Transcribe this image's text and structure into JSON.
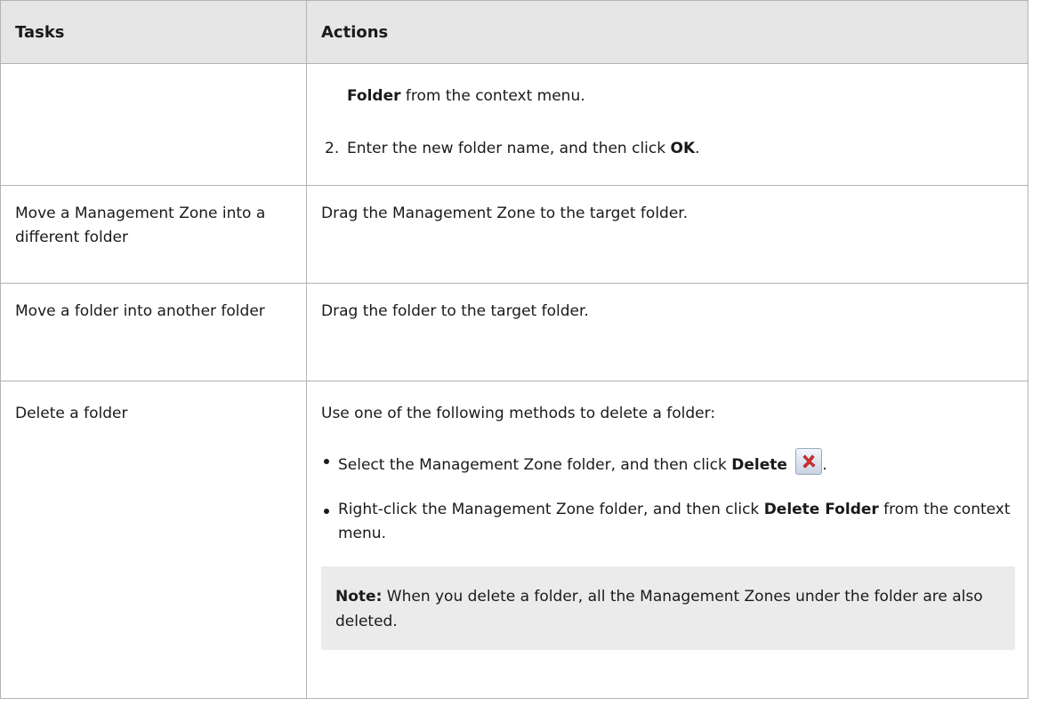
{
  "table": {
    "headers": {
      "tasks": "Tasks",
      "actions": "Actions"
    },
    "row1": {
      "task": "",
      "step1_bold": "Folder",
      "step1_rest": " from the context menu.",
      "step2_num": "2.",
      "step2_text": "Enter the new folder name, and then click ",
      "step2_bold": "OK",
      "step2_end": "."
    },
    "row2": {
      "task": "Move a Management Zone into a different folder",
      "action": "Drag the Management Zone to the target folder."
    },
    "row3": {
      "task": "Move a folder into another folder",
      "action": "Drag the folder to the target folder."
    },
    "row4": {
      "task": "Delete a folder",
      "intro": "Use one of the following methods to delete a folder:",
      "bullet1_text": "Select the Management Zone folder, and then click ",
      "bullet1_bold": "Delete",
      "bullet1_end": ".",
      "bullet2_text": "Right-click the Management Zone folder, and then click ",
      "bullet2_bold": "Delete Folder",
      "bullet2_end": " from the context menu.",
      "note_label": "Note:",
      "note_text": " When you delete a folder, all the Management Zones under the folder are also deleted."
    }
  },
  "icons": {
    "delete": "delete-x-icon"
  },
  "colors": {
    "header_bg": "#e6e6e6",
    "note_bg": "#ebebeb",
    "border": "#b3b3b3",
    "delete_red": "#d9302f"
  }
}
